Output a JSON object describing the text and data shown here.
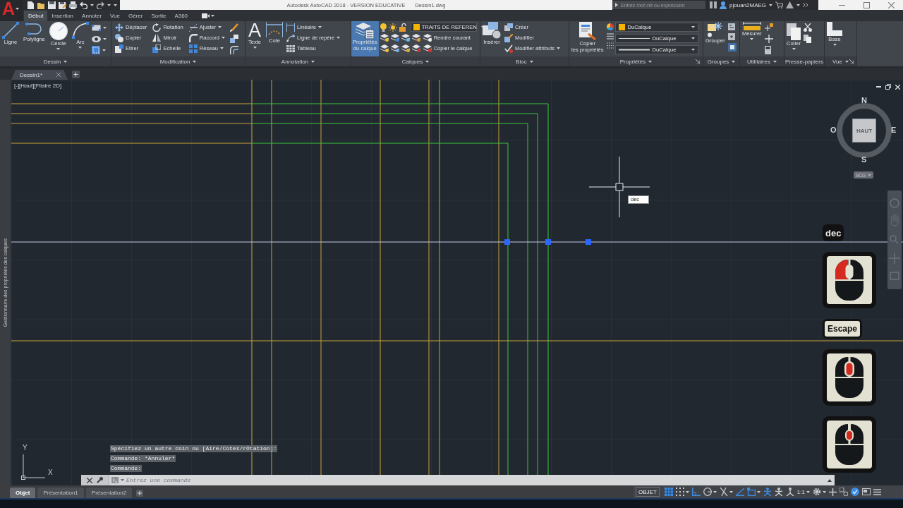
{
  "title_bar": {
    "logo": "A",
    "title": "Autodesk AutoCAD 2018 - VERSION EDUCATIVE",
    "file": "Dessin1.dwg",
    "search": {
      "placeholder": "Entrez mot-clé ou expression"
    },
    "user": "pjouan2MAEG"
  },
  "ribbon_tabs": [
    {
      "label": "Début",
      "selected": true
    },
    {
      "label": "Insertion",
      "selected": false
    },
    {
      "label": "Annoter",
      "selected": false
    },
    {
      "label": "Vue",
      "selected": false
    },
    {
      "label": "Gérer",
      "selected": false
    },
    {
      "label": "Sortie",
      "selected": false
    },
    {
      "label": "A360",
      "selected": false
    }
  ],
  "ribbon_panels": [
    {
      "kind": "draw",
      "title": "Dessin",
      "menu": true,
      "launcher": false,
      "large": [
        {
          "label": "Ligne",
          "menu": false,
          "active": false
        },
        {
          "label": "Polyligne",
          "menu": false,
          "active": false
        },
        {
          "label": "Cercle",
          "menu": true,
          "active": false
        },
        {
          "label": "Arc",
          "menu": true,
          "active": false
        }
      ]
    },
    {
      "kind": "modify",
      "title": "Modification",
      "menu": true,
      "launcher": false,
      "columns": [
        [
          {
            "label": "Déplacer",
            "menu": false
          },
          {
            "label": "Copier",
            "menu": false
          },
          {
            "label": "Etirer",
            "menu": false
          }
        ],
        [
          {
            "label": "Rotation",
            "menu": false
          },
          {
            "label": "Miroir",
            "menu": false
          },
          {
            "label": "Echelle",
            "menu": false
          }
        ],
        [
          {
            "label": "Ajuster",
            "menu": true
          },
          {
            "label": "Raccord",
            "menu": true
          },
          {
            "label": "Réseau",
            "menu": true
          }
        ]
      ]
    },
    {
      "kind": "annotation",
      "title": "Annotation",
      "menu": true,
      "launcher": false,
      "large": [
        {
          "label": "Texte",
          "glyph": "A",
          "menu": true,
          "active": false
        },
        {
          "label": "Cote",
          "menu": false,
          "active": false
        }
      ],
      "columns": [
        [
          {
            "label": "Linéaire",
            "menu": true
          },
          {
            "label": "Ligne de repère",
            "menu": true
          },
          {
            "label": "Tableau",
            "menu": false
          }
        ]
      ]
    },
    {
      "kind": "layers",
      "title": "Calques",
      "menu": true,
      "launcher": false,
      "large": [
        {
          "label": "Propriétés\ndu calque",
          "menu": false,
          "active": true
        }
      ],
      "layer": {
        "name": "TRAITS DE REFEREN",
        "color": "#f5b400"
      },
      "columns": [
        [
          {
            "label": "Rendre courant",
            "menu": false
          },
          {
            "label": "Copier le calque",
            "menu": false
          }
        ]
      ]
    },
    {
      "kind": "block",
      "title": "Bloc",
      "menu": true,
      "launcher": false,
      "large": [
        {
          "label": "Insérer",
          "menu": false,
          "active": false
        }
      ],
      "columns": [
        [
          {
            "label": "Créer",
            "menu": false
          },
          {
            "label": "Modifier",
            "menu": false
          },
          {
            "label": "Modifier attributs",
            "menu": true
          }
        ]
      ]
    },
    {
      "kind": "properties",
      "title": "Propriétés",
      "menu": true,
      "launcher": true,
      "large": [
        {
          "label": "Copier\nles propriétés",
          "menu": false,
          "active": false
        }
      ],
      "dropdowns": [
        {
          "kind": "color",
          "value": "DuCalque",
          "color": "#f5b400"
        },
        {
          "kind": "linetype",
          "value": "DuCalque"
        },
        {
          "kind": "lineweight",
          "value": "DuCalque"
        }
      ]
    },
    {
      "kind": "groups",
      "title": "Groupes",
      "menu": true,
      "launcher": false,
      "large": [
        {
          "label": "Grouper",
          "menu": false,
          "active": false
        }
      ]
    },
    {
      "kind": "utilities",
      "title": "Utilitaires",
      "menu": true,
      "launcher": false,
      "large": [
        {
          "label": "Mesurer",
          "menu": true,
          "active": false
        }
      ]
    },
    {
      "kind": "clipboard",
      "title": "Presse-papiers",
      "menu": false,
      "launcher": false,
      "large": [
        {
          "label": "Coller",
          "menu": true,
          "active": false
        }
      ]
    },
    {
      "kind": "view",
      "title": "Vue",
      "menu": true,
      "launcher": true,
      "large": [
        {
          "label": "Base",
          "menu": true,
          "active": false
        }
      ]
    }
  ],
  "document_tabs": [
    {
      "label": "Dessin1*",
      "selected": true
    }
  ],
  "side_palette": {
    "title": "Gestionnaire des propriétés des calques"
  },
  "viewport": {
    "label": "[-][Haut][Filaire 2D]"
  },
  "viewcube": {
    "face": "HAUT",
    "north": "N",
    "south": "S",
    "east": "E",
    "west": "O",
    "coordinate_system": "SCG"
  },
  "cursor": {
    "dynamic_input": "dec"
  },
  "keystroke_overlay": [
    {
      "kind": "text",
      "label": "dec"
    },
    {
      "kind": "mouse_left"
    },
    {
      "kind": "key",
      "label": "Escape"
    },
    {
      "kind": "mouse_middle"
    },
    {
      "kind": "mouse_wheel"
    }
  ],
  "ucs_icon": {
    "x_label": "X",
    "y_label": "Y"
  },
  "command_line": {
    "history": [
      "Spécifiez un autre coin ou [Aire/Cotes/rOtation]:",
      "Commande: *Annuler*",
      "Commande:"
    ],
    "placeholder": "Entrez une commande"
  },
  "layout_tabs": [
    {
      "label": "Objet",
      "selected": true
    },
    {
      "label": "Présentation1",
      "selected": false
    },
    {
      "label": "Présentation2",
      "selected": false
    }
  ],
  "status_bar": {
    "space": "OBJET",
    "annotation_scale": "1:1",
    "toggles": [
      {
        "on": true
      },
      {
        "on": false
      },
      {
        "on": true
      },
      {
        "on": false
      },
      {
        "on": false
      },
      {
        "on": true
      },
      {
        "on": true
      },
      {
        "on": true
      },
      {
        "on": false
      },
      {
        "on": false
      },
      {
        "on": true
      }
    ]
  }
}
